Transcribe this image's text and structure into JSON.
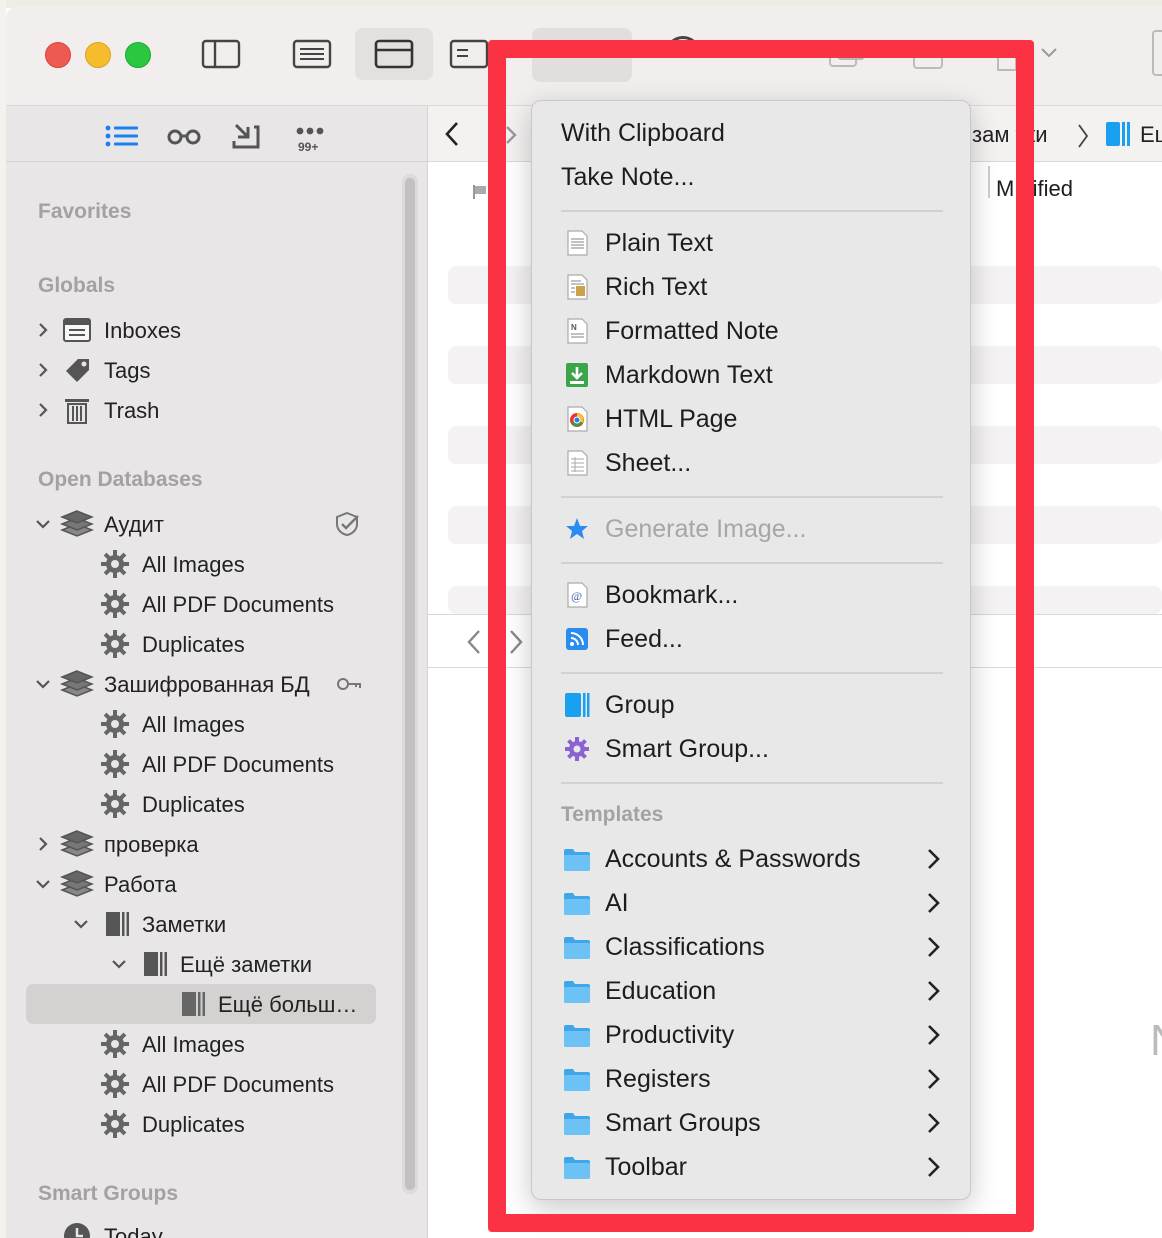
{
  "sidebar": {
    "badge": "99+",
    "sections": {
      "favorites": "Favorites",
      "globals": "Globals",
      "open_databases": "Open Databases",
      "smart_groups": "Smart Groups"
    },
    "globals": {
      "inboxes": "Inboxes",
      "tags": "Tags",
      "trash": "Trash"
    },
    "db_audit": {
      "name": "Аудит",
      "items": [
        "All Images",
        "All PDF Documents",
        "Duplicates"
      ]
    },
    "db_encrypted": {
      "name": "Зашифрованная БД",
      "items": [
        "All Images",
        "All PDF Documents",
        "Duplicates"
      ]
    },
    "db_check": {
      "name": "проверка"
    },
    "db_work": {
      "name": "Работа",
      "group1": "Заметки",
      "group2": "Ещё заметки",
      "group3": "Ещё больш…",
      "items": [
        "All Images",
        "All PDF Documents",
        "Duplicates"
      ]
    },
    "smart_today": "Today"
  },
  "main": {
    "crumb_group": "зам  тки",
    "crumb_current": "Ещ",
    "column_modified": "M  dified",
    "right_fragment": "N"
  },
  "menu": {
    "with_clipboard": "With Clipboard",
    "take_note": "Take Note...",
    "plain_text": "Plain Text",
    "rich_text": "Rich Text",
    "formatted_note": "Formatted Note",
    "markdown_text": "Markdown Text",
    "html_page": "HTML Page",
    "sheet": "Sheet...",
    "generate_image": "Generate Image...",
    "bookmark": "Bookmark...",
    "feed": "Feed...",
    "group": "Group",
    "smart_group": "Smart Group...",
    "templates_header": "Templates",
    "templates": [
      "Accounts & Passwords",
      "AI",
      "Classifications",
      "Education",
      "Productivity",
      "Registers",
      "Smart Groups",
      "Toolbar"
    ]
  },
  "colors": {
    "highlight": "#fa3244",
    "folder_blue": "#5bb8f2",
    "accent_blue": "#1a7ff0"
  }
}
